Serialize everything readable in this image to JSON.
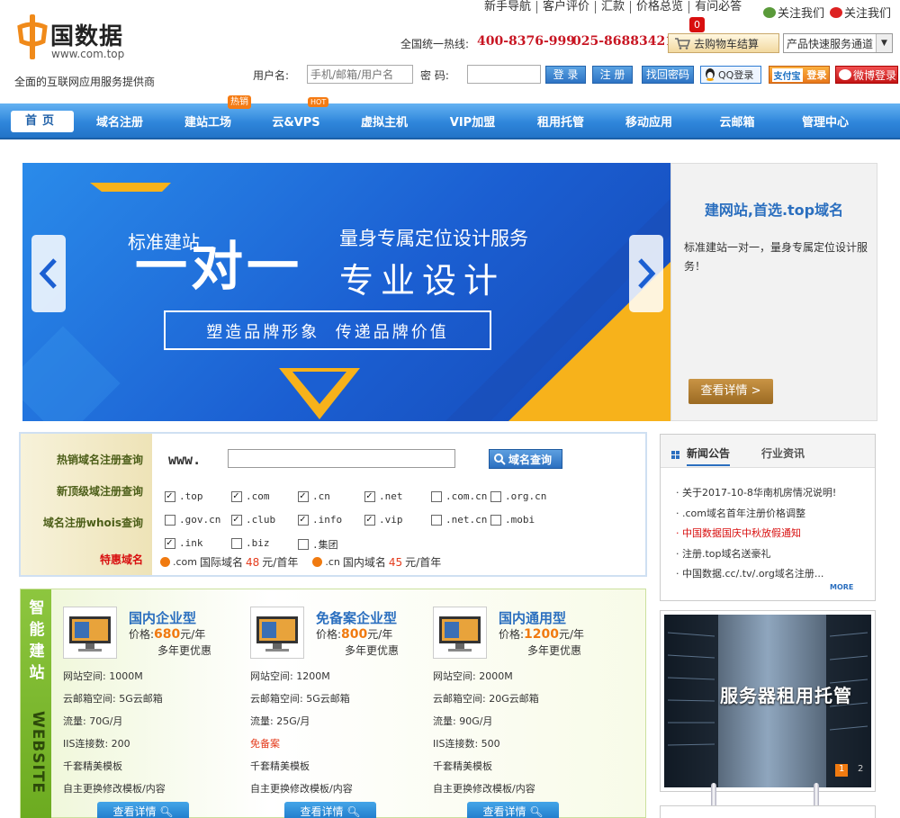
{
  "header": {
    "logo_text": "国数据",
    "logo_sub": "www.com.top",
    "slogan": "全面的互联网应用服务提供商",
    "topnav": [
      "新手导航",
      "客户评价",
      "汇款",
      "价格总览",
      "有问必答"
    ],
    "follow_weixin": "关注我们",
    "follow_weibo": "关注我们",
    "hotline_label": "全国统一热线:",
    "hotline_1": "400-8376-999",
    "hotline_2": "025-86883421",
    "cart_label": "去购物车结算",
    "cart_count": "0",
    "service_select": "产品快速服务通道",
    "username_label": "用户名:",
    "username_placeholder": "手机/邮箱/用户名",
    "password_label": "密  码:",
    "login": "登 录",
    "register": "注 册",
    "find_password": "找回密码",
    "qq_login": "QQ登录",
    "alipay_logo": "支付宝",
    "alipay_login": "登录",
    "weibo_login": "微博登录"
  },
  "nav": {
    "home": "首页",
    "items": [
      "域名注册",
      "建站工场",
      "云&VPS",
      "虚拟主机",
      "VIP加盟",
      "租用托管",
      "移动应用",
      "云邮箱",
      "管理中心"
    ],
    "tag_hot_cn": "热销",
    "tag_hot_en": "HOT"
  },
  "banner": {
    "line_small": "标准建站",
    "line_big": "一对一",
    "line_right1": "量身专属定位设计服务",
    "line_right2": "专业设计",
    "slogan": "塑造品牌形象  传递品牌价值",
    "info_title": "建网站,首选.top域名",
    "info_desc": "标准建站一对一，量身专属定位设计服务！",
    "info_button": "查看详情 >"
  },
  "domain": {
    "tabs": [
      "热销域名注册查询",
      "新顶级域注册查询",
      "域名注册whois查询",
      "特惠域名"
    ],
    "www": "www.",
    "query_button": "域名查询",
    "options": [
      {
        "label": ".top",
        "checked": true
      },
      {
        "label": ".com",
        "checked": true
      },
      {
        "label": ".cn",
        "checked": true
      },
      {
        "label": ".net",
        "checked": true
      },
      {
        "label": ".com.cn",
        "checked": false
      },
      {
        "label": ".org.cn",
        "checked": false
      },
      {
        "label": ".gov.cn",
        "checked": false
      },
      {
        "label": ".club",
        "checked": true
      },
      {
        "label": ".info",
        "checked": true
      },
      {
        "label": ".vip",
        "checked": true
      },
      {
        "label": ".net.cn",
        "checked": false
      },
      {
        "label": ".mobi",
        "checked": false
      },
      {
        "label": ".ink",
        "checked": true
      },
      {
        "label": ".biz",
        "checked": false
      },
      {
        "label": ".集团",
        "checked": false
      }
    ],
    "promo_1_ext": ".com",
    "promo_1_text": "国际域名",
    "promo_1_price": "48",
    "promo_1_unit": "元/首年",
    "promo_2_ext": ".cn",
    "promo_2_text": "国内域名",
    "promo_2_price": "45",
    "promo_2_unit": "元/首年"
  },
  "news": {
    "tab_1": "新闻公告",
    "tab_2": "行业资讯",
    "items": [
      {
        "text": "关于2017-10-8华南机房情况说明!",
        "color": "#333333"
      },
      {
        "text": ".com域名首年注册价格调整",
        "color": "#333333"
      },
      {
        "text": "中国数据国庆中秋放假通知",
        "color": "#d80f0f"
      },
      {
        "text": "注册.top域名送豪礼",
        "color": "#333333"
      },
      {
        "text": "中国数据.cc/.tv/.org域名注册...",
        "color": "#333333"
      }
    ],
    "more": "MORE",
    "server_banner": "服务器租用托管",
    "slide_1": "1",
    "slide_2": "2"
  },
  "products": {
    "side_cn": "智能建站",
    "side_en": "WEBSITE",
    "price_label": "价格:",
    "unit": "元/年",
    "discount": "多年更优惠",
    "button": "查看详情",
    "items": [
      {
        "title": "国内企业型",
        "price": "680",
        "space": "网站空间: 1000M",
        "mail": "云邮箱空间: 5G云邮箱",
        "flow": "流量: 70G/月",
        "iis": "IIS连接数: 200",
        "tpl": "千套精美模板",
        "custom": "自主更换修改模板/内容"
      },
      {
        "title": "免备案企业型",
        "price": "800",
        "space": "网站空间: 1200M",
        "mail": "云邮箱空间: 5G云邮箱",
        "flow": "流量: 25G/月",
        "iis": "免备案",
        "tpl": "千套精美模板",
        "custom": "自主更换修改模板/内容"
      },
      {
        "title": "国内通用型",
        "price": "1200",
        "space": "网站空间: 2000M",
        "mail": "云邮箱空间: 20G云邮箱",
        "flow": "流量: 90G/月",
        "iis": "IIS连接数: 500",
        "tpl": "千套精美模板",
        "custom": "自主更换修改模板/内容"
      }
    ]
  },
  "colors": {
    "brand_blue": "#2f86db",
    "accent_red": "#c81623",
    "accent_orange": "#f07a10"
  }
}
